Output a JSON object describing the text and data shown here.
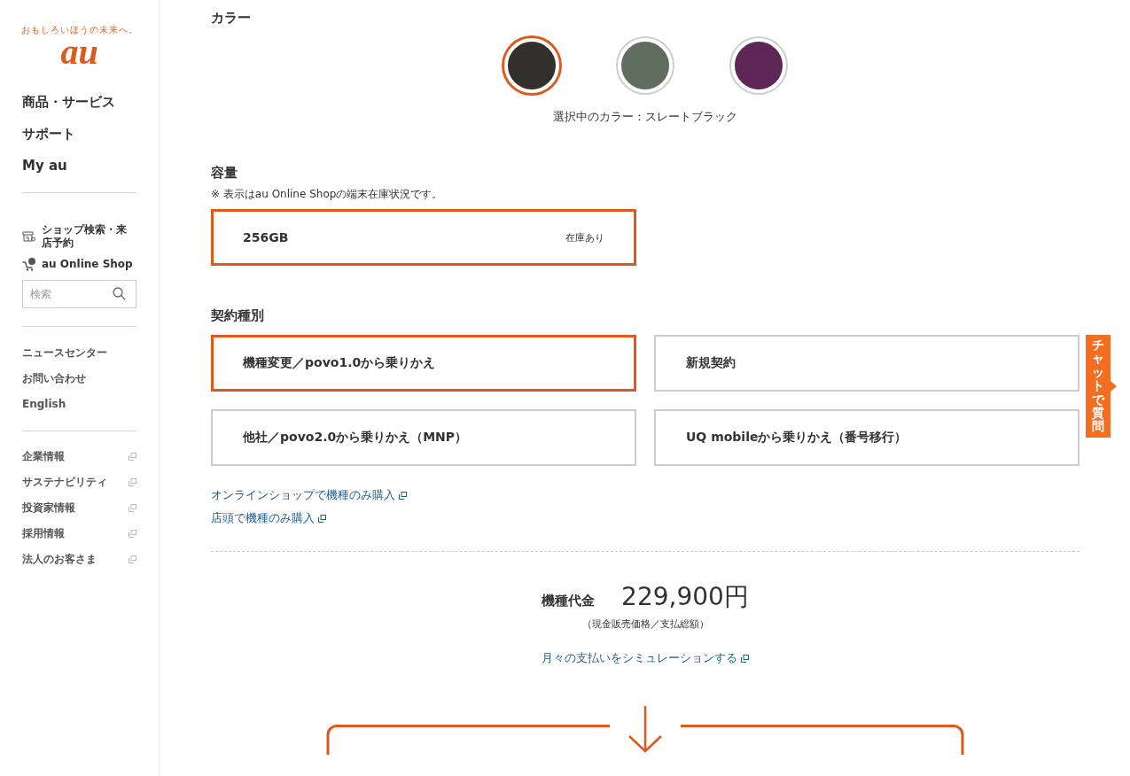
{
  "logo": {
    "tagline": "おもしろいほうの未来へ。",
    "wordmark": "au"
  },
  "sidebar": {
    "primary_nav": [
      "商品・サービス",
      "サポート",
      "My au"
    ],
    "shop_links": [
      {
        "label": "ショップ検索・来店予約",
        "kind": "store"
      },
      {
        "label": "au Online Shop",
        "kind": "cart"
      }
    ],
    "search": {
      "placeholder": "検索"
    },
    "secondary_nav": [
      "ニュースセンター",
      "お問い合わせ",
      "English"
    ],
    "corporate_links": [
      "企業情報",
      "サステナビリティ",
      "投資家情報",
      "採用情報",
      "法人のお客さま"
    ]
  },
  "color_section": {
    "title": "カラー",
    "swatches": [
      {
        "color": "#32302d",
        "selected": true
      },
      {
        "color": "#5f6e5e",
        "selected": false
      },
      {
        "color": "#5e2656",
        "selected": false
      }
    ],
    "caption": "選択中のカラー：スレートブラック"
  },
  "capacity_section": {
    "title": "容量",
    "note": "※  表示はau Online Shopの端末在庫状況です。",
    "options": [
      {
        "label": "256GB",
        "stock": "在庫あり",
        "selected": true
      }
    ]
  },
  "contract_section": {
    "title": "契約種別",
    "options": [
      {
        "label": "機種変更／povo1.0から乗りかえ",
        "selected": true
      },
      {
        "label": "新規契約",
        "selected": false
      },
      {
        "label": "他社／povo2.0から乗りかえ（MNP）",
        "selected": false
      },
      {
        "label": "UQ mobileから乗りかえ（番号移行）",
        "selected": false
      }
    ]
  },
  "links": [
    "オンラインショップで機種のみ購入",
    "店頭で機種のみ購入"
  ],
  "price": {
    "label": "機種代金",
    "amount": "229,900円",
    "note": "（現金販売価格／支払総額）",
    "simulation_link": "月々の支払いをシミュレーションする"
  },
  "chat_tab": {
    "label": "チャットで質問"
  }
}
